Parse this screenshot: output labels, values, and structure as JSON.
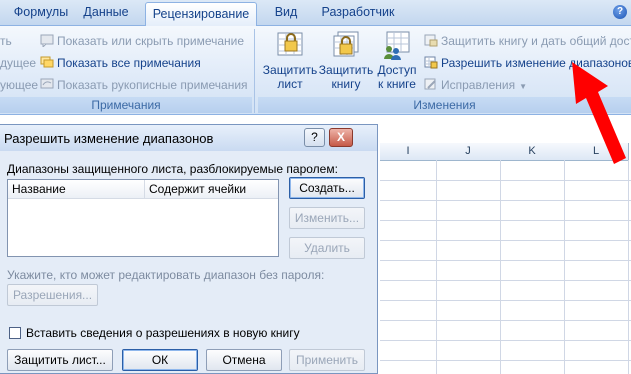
{
  "ribbon_tabs": [
    "Формулы",
    "Данные",
    "Рецензирование",
    "Вид",
    "Разработчик"
  ],
  "notes_group": {
    "label": "Примечания",
    "items": [
      {
        "label": "Показать или скрыть примечание",
        "enabled": false
      },
      {
        "label": "Показать все примечания",
        "enabled": true
      },
      {
        "label": "Показать рукописные примечания",
        "enabled": false
      }
    ],
    "clipped_left": [
      "ть",
      "дущее",
      "ующее"
    ]
  },
  "changes_group": {
    "label": "Изменения",
    "big_buttons": [
      {
        "line1": "Защитить",
        "line2": "лист"
      },
      {
        "line1": "Защитить",
        "line2": "книгу"
      },
      {
        "line1": "Доступ",
        "line2": "к книге"
      }
    ],
    "items": [
      {
        "label": "Защитить книгу и дать общий досту",
        "enabled": false
      },
      {
        "label": "Разрешить изменение диапазонов",
        "enabled": true
      },
      {
        "label": "Исправления",
        "enabled": false
      }
    ]
  },
  "columns": [
    "I",
    "J",
    "K",
    "L"
  ],
  "dialog": {
    "title": "Разрешить изменение диапазонов",
    "help_button": "?",
    "close_button": "X",
    "ranges_label": "Диапазоны защищенного листа, разблокируемые паролем:",
    "list_headers": [
      "Название",
      "Содержит ячейки"
    ],
    "who_label": "Укажите, кто может редактировать диапазон без пароля:",
    "permissions_button": "Разрешения...",
    "checkbox_label": "Вставить сведения о разрешениях в новую книгу",
    "checkbox_checked": false,
    "buttons": {
      "create": "Создать...",
      "edit": "Изменить...",
      "delete": "Удалить",
      "protect_sheet": "Защитить лист...",
      "ok": "ОК",
      "cancel": "Отмена",
      "apply": "Применить"
    }
  },
  "colors": {
    "ribbon_text": "#15428b",
    "arrow": "#ff0000"
  }
}
